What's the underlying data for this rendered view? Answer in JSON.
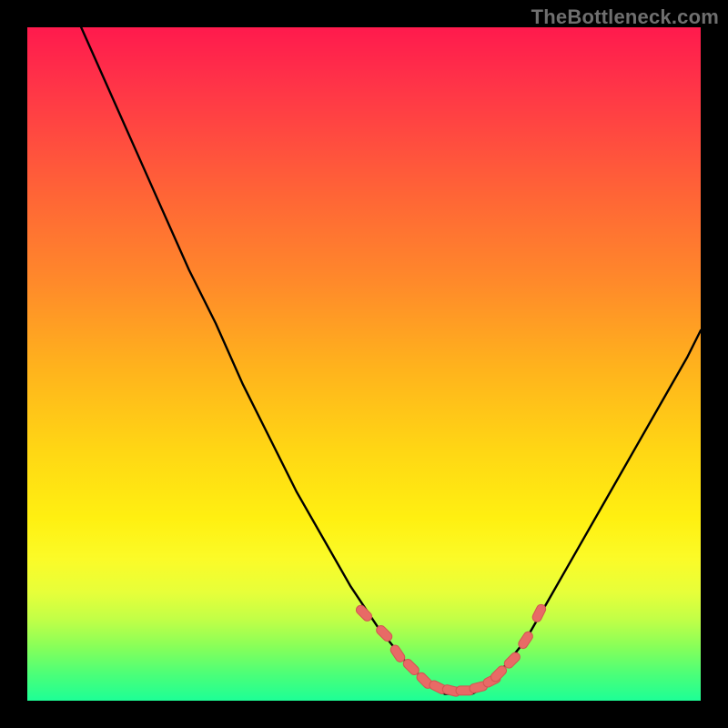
{
  "watermark": "TheBottleneck.com",
  "colors": {
    "curve_stroke": "#000000",
    "marker_fill": "#e86a66",
    "marker_stroke": "#d25551"
  },
  "chart_data": {
    "type": "line",
    "title": "",
    "xlabel": "",
    "ylabel": "",
    "xlim": [
      0,
      100
    ],
    "ylim": [
      0,
      100
    ],
    "grid": false,
    "legend": false,
    "series": [
      {
        "name": "bottleneck-curve",
        "x": [
          8,
          12,
          16,
          20,
          24,
          28,
          32,
          36,
          40,
          44,
          48,
          52,
          56,
          58,
          60,
          62,
          64,
          66,
          68,
          70,
          74,
          78,
          82,
          86,
          90,
          94,
          98,
          100
        ],
        "y": [
          100,
          91,
          82,
          73,
          64,
          56,
          47,
          39,
          31,
          24,
          17,
          11,
          6,
          4,
          2,
          1,
          1,
          1,
          2,
          4,
          9,
          16,
          23,
          30,
          37,
          44,
          51,
          55
        ]
      }
    ],
    "markers": {
      "name": "highlighted-range",
      "x": [
        50,
        53,
        55,
        57,
        59,
        61,
        63,
        65,
        67,
        69,
        70,
        72,
        74,
        76
      ],
      "y": [
        13,
        10,
        7,
        5,
        3,
        2,
        1.5,
        1.5,
        2,
        3,
        4,
        6,
        9,
        13
      ]
    }
  }
}
